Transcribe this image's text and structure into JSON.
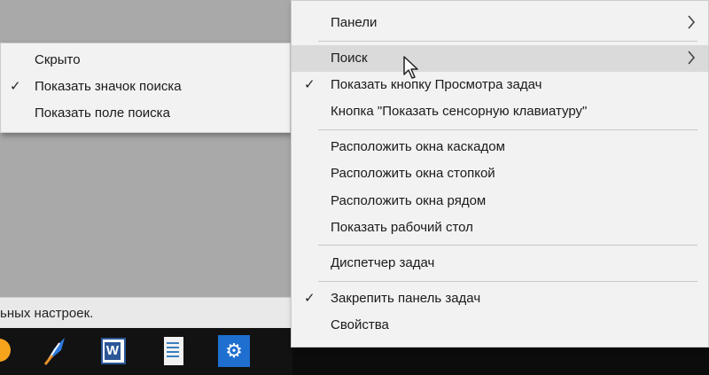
{
  "desktop": {
    "status_text": "ьных настроек."
  },
  "taskbar": {
    "icons": [
      "orange-app-icon",
      "feather-app-icon",
      "word-icon",
      "document-icon",
      "settings-gear-icon"
    ]
  },
  "submenu": {
    "items": [
      {
        "label": "Скрыто",
        "checked": false
      },
      {
        "label": "Показать значок поиска",
        "checked": true
      },
      {
        "label": "Показать поле поиска",
        "checked": false
      }
    ]
  },
  "main_menu": {
    "items": [
      {
        "label": "Панели",
        "has_submenu": true
      },
      {
        "label": "Поиск",
        "has_submenu": true,
        "highlighted": true
      },
      {
        "label": "Показать кнопку Просмотра задач",
        "checked": true
      },
      {
        "label": "Кнопка \"Показать сенсорную клавиатуру\""
      },
      {
        "label": "Расположить окна каскадом"
      },
      {
        "label": "Расположить окна стопкой"
      },
      {
        "label": "Расположить окна рядом"
      },
      {
        "label": "Показать рабочий стол"
      },
      {
        "label": "Диспетчер задач"
      },
      {
        "label": "Закрепить панель задач",
        "checked": true
      },
      {
        "label": "Свойства"
      }
    ]
  },
  "glyphs": {
    "check": "✓"
  }
}
